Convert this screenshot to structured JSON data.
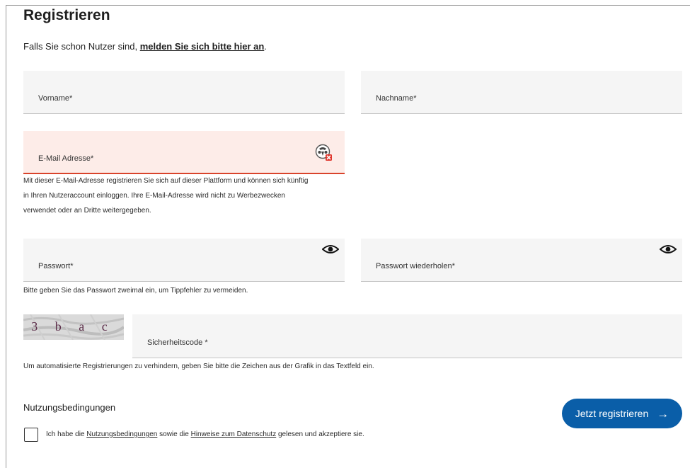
{
  "form": {
    "title": "Registrieren",
    "intro_text": "Falls Sie schon Nutzer sind, ",
    "intro_link": "melden Sie sich bitte hier an",
    "intro_end": ".",
    "fields": {
      "firstname_label": "Vorname*",
      "lastname_label": "Nachname*",
      "email_label": "E-Mail Adresse*",
      "password_label": "Passwort*",
      "password_repeat_label": "Passwort wiederholen*",
      "captcha_label": "Sicherheitscode *"
    },
    "help": {
      "email_line1": "Mit dieser E-Mail-Adresse registrieren Sie sich auf dieser Plattform und können sich künftig",
      "email_line2": "in Ihren Nutzeraccount einloggen. Ihre E-Mail-Adresse wird nicht zu Werbezwecken",
      "email_line3": "verwendet oder an Dritte weitergegeben.",
      "password": "Bitte geben Sie das Passwort zweimal ein, um Tippfehler zu vermeiden.",
      "captcha": "Um automatisierte Registrierungen zu verhindern, geben Sie bitte die Zeichen aus der Grafik in das Textfeld ein."
    },
    "captcha_text": "3 b a c",
    "terms": {
      "heading": "Nutzungsbedingungen",
      "prefix": "Ich habe die ",
      "terms_link": "Nutzungsbedingungen",
      "middle": " sowie die ",
      "privacy_link": "Hinweise zum Datenschutz",
      "suffix": " gelesen und akzeptiere sie."
    },
    "submit_label": "Jetzt registrieren",
    "submit_arrow": "→"
  },
  "colors": {
    "accent": "#0a5ea8",
    "error": "#d9432b",
    "error_bg": "#fdece8",
    "field_bg": "#f5f5f5"
  },
  "icons": {
    "password_toggle": "eye-icon",
    "password_repeat_toggle": "eye-icon",
    "email_status": "error-badge-icon",
    "submit": "arrow-right-icon"
  }
}
